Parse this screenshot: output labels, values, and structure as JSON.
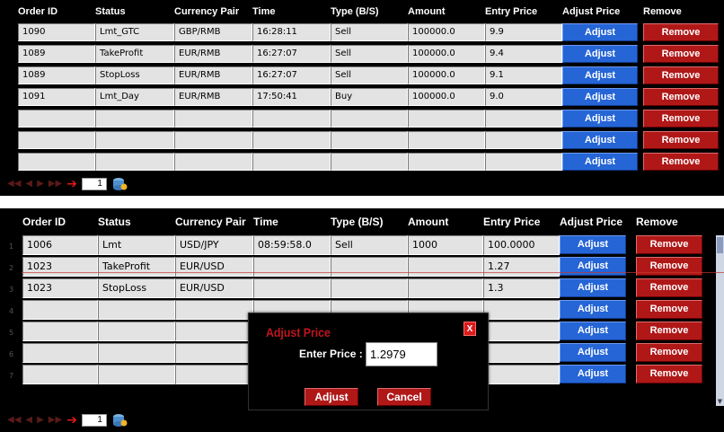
{
  "top_grid": {
    "columns": [
      "Order ID",
      "Status",
      "Currency Pair",
      "Time",
      "Type (B/S)",
      "Amount",
      "Entry Price",
      "Adjust Price",
      "Remove"
    ],
    "rows": [
      {
        "order_id": "1090",
        "status": "Lmt_GTC",
        "pair": "GBP/RMB",
        "time": "16:28:11",
        "type": "Sell",
        "amount": "100000.0",
        "entry": "9.9"
      },
      {
        "order_id": "1089",
        "status": "TakeProfit",
        "pair": "EUR/RMB",
        "time": "16:27:07",
        "type": "Sell",
        "amount": "100000.0",
        "entry": "9.4"
      },
      {
        "order_id": "1089",
        "status": "StopLoss",
        "pair": "EUR/RMB",
        "time": "16:27:07",
        "type": "Sell",
        "amount": "100000.0",
        "entry": "9.1"
      },
      {
        "order_id": "1091",
        "status": "Lmt_Day",
        "pair": "EUR/RMB",
        "time": "17:50:41",
        "type": "Buy",
        "amount": "100000.0",
        "entry": "9.0"
      },
      {
        "order_id": "",
        "status": "",
        "pair": "",
        "time": "",
        "type": "",
        "amount": "",
        "entry": ""
      },
      {
        "order_id": "",
        "status": "",
        "pair": "",
        "time": "",
        "type": "",
        "amount": "",
        "entry": ""
      },
      {
        "order_id": "",
        "status": "",
        "pair": "",
        "time": "",
        "type": "",
        "amount": "",
        "entry": ""
      }
    ],
    "adjust_label": "Adjust",
    "remove_label": "Remove",
    "page_number": "1"
  },
  "bottom_grid": {
    "columns": [
      "Order ID",
      "Status",
      "Currency Pair",
      "Time",
      "Type (B/S)",
      "Amount",
      "Entry Price",
      "Adjust Price",
      "Remove"
    ],
    "row_numbers": [
      "1",
      "2",
      "3",
      "4",
      "5",
      "6",
      "7"
    ],
    "rows": [
      {
        "order_id": "1006",
        "status": "Lmt",
        "pair": "USD/JPY",
        "time": "08:59:58.0",
        "type": "Sell",
        "amount": "1000",
        "entry": "100.0000"
      },
      {
        "order_id": "1023",
        "status": "TakeProfit",
        "pair": "EUR/USD",
        "time": "",
        "type": "",
        "amount": "",
        "entry": "1.27"
      },
      {
        "order_id": "1023",
        "status": "StopLoss",
        "pair": "EUR/USD",
        "time": "",
        "type": "",
        "amount": "",
        "entry": "1.3"
      },
      {
        "order_id": "",
        "status": "",
        "pair": "",
        "time": "",
        "type": "",
        "amount": "",
        "entry": ""
      },
      {
        "order_id": "",
        "status": "",
        "pair": "",
        "time": "",
        "type": "",
        "amount": "",
        "entry": ""
      },
      {
        "order_id": "",
        "status": "",
        "pair": "",
        "time": "",
        "type": "",
        "amount": "",
        "entry": ""
      },
      {
        "order_id": "",
        "status": "",
        "pair": "",
        "time": "",
        "type": "",
        "amount": "",
        "entry": ""
      }
    ],
    "adjust_label": "Adjust",
    "remove_label": "Remove",
    "page_number": "1"
  },
  "dialog": {
    "title": "Adjust Price",
    "close_label": "X",
    "price_label": "Enter Price :",
    "price_value": "1.2979",
    "adjust_label": "Adjust",
    "cancel_label": "Cancel"
  },
  "colors": {
    "adjust_button": "#2565d6",
    "remove_button": "#b01818",
    "dialog_title": "#c0161e"
  }
}
